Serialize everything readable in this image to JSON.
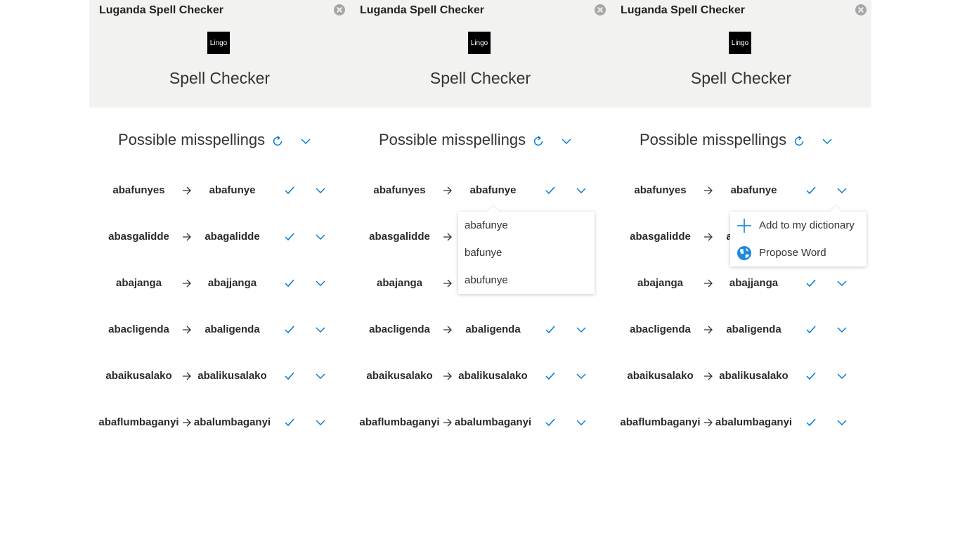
{
  "app": {
    "title": "Luganda Spell Checker",
    "logo_text": "Lingo",
    "name": "Spell Checker"
  },
  "section": {
    "title": "Possible misspellings"
  },
  "rows": [
    {
      "original": "abafunyes",
      "suggestion": "abafunye"
    },
    {
      "original": "abasgalidde",
      "suggestion": "abagalidde"
    },
    {
      "original": "abajanga",
      "suggestion": "abajjanga"
    },
    {
      "original": "abacligenda",
      "suggestion": "abaligenda"
    },
    {
      "original": "abaikusalako",
      "suggestion": "abalikusalako"
    },
    {
      "original": "abaflumbaganyi",
      "suggestion": "abalumbaganyi"
    }
  ],
  "suggestion_dropdown": [
    "abafunye",
    "bafunye",
    "abufunye"
  ],
  "options_menu": {
    "add_to_dictionary": "Add to my dictionary",
    "propose_word": "Propose Word"
  },
  "colors": {
    "accent": "#0078d4",
    "header_bg": "#f2f2f1"
  },
  "icons": [
    "close-icon",
    "refresh-icon",
    "chevron-down-icon",
    "arrow-right-icon",
    "checkmark-icon",
    "plus-icon",
    "globe-icon"
  ]
}
